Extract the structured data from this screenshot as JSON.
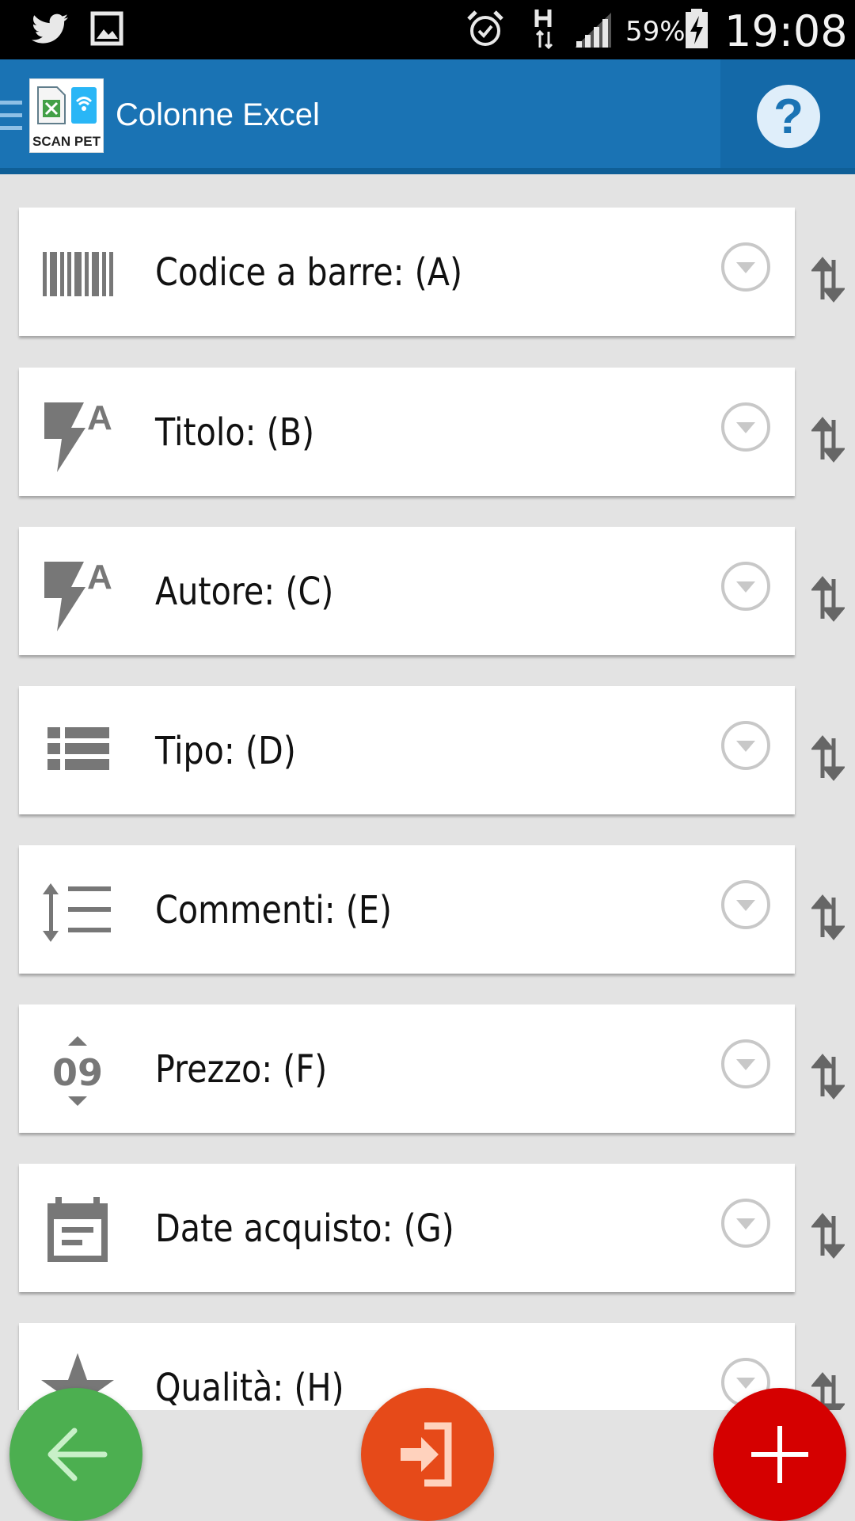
{
  "status_bar": {
    "battery": "59%",
    "time": "19:08",
    "network": "H",
    "icons": [
      "twitter-icon",
      "image-icon",
      "alarm-icon",
      "network-h-icon",
      "signal-icon",
      "battery-charging-icon"
    ]
  },
  "app_bar": {
    "title": "Colonne Excel",
    "logo_text": "SCAN PET",
    "help_label": "?",
    "color": "#1a73b4"
  },
  "columns": [
    {
      "label": "Codice a barre: (A)",
      "icon": "barcode-icon"
    },
    {
      "label": "Titolo: (B)",
      "icon": "flash-text-icon"
    },
    {
      "label": "Autore: (C)",
      "icon": "flash-text-icon"
    },
    {
      "label": "Tipo: (D)",
      "icon": "list-icon"
    },
    {
      "label": "Commenti: (E)",
      "icon": "line-spacing-icon"
    },
    {
      "label": "Prezzo: (F)",
      "icon": "number-stepper-icon"
    },
    {
      "label": "Date acquisto: (G)",
      "icon": "calendar-icon"
    },
    {
      "label": "Qualità: (H)",
      "icon": "star-icon"
    }
  ],
  "fabs": {
    "back": {
      "icon": "arrow-left-icon",
      "color": "#4caf50"
    },
    "import": {
      "icon": "sign-in-icon",
      "color": "#e64a19"
    },
    "add": {
      "icon": "plus-icon",
      "color": "#d50000"
    }
  }
}
